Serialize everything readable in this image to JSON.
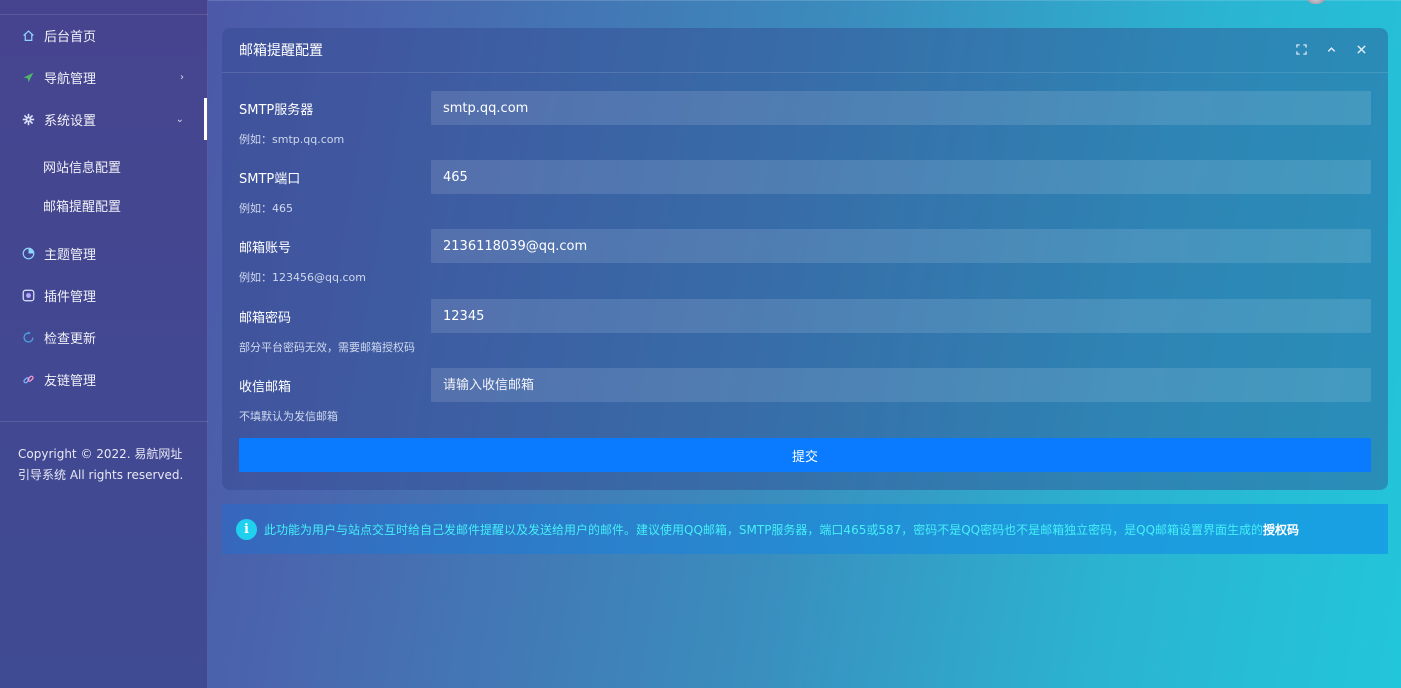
{
  "sidebar": {
    "items": [
      {
        "label": "后台首页",
        "icon": "home-icon"
      },
      {
        "label": "导航管理",
        "icon": "navigation-icon",
        "arrow": "›"
      },
      {
        "label": "系统设置",
        "icon": "gear-icon",
        "arrow": "⌄"
      },
      {
        "label": "主题管理",
        "icon": "theme-icon"
      },
      {
        "label": "插件管理",
        "icon": "plugin-icon"
      },
      {
        "label": "检查更新",
        "icon": "refresh-icon"
      },
      {
        "label": "友链管理",
        "icon": "link-icon"
      }
    ],
    "sub_items": [
      {
        "label": "网站信息配置"
      },
      {
        "label": "邮箱提醒配置"
      }
    ],
    "copyright": "Copyright © 2022. 易航网址引导系统 All rights reserved."
  },
  "card": {
    "title": "邮箱提醒配置",
    "fields": [
      {
        "label": "SMTP服务器",
        "value": "smtp.qq.com",
        "placeholder": "",
        "hint": "例如：smtp.qq.com"
      },
      {
        "label": "SMTP端口",
        "value": "465",
        "placeholder": "",
        "hint": "例如：465"
      },
      {
        "label": "邮箱账号",
        "value": "2136118039@qq.com",
        "placeholder": "",
        "hint": "例如：123456@qq.com"
      },
      {
        "label": "邮箱密码",
        "value": "12345",
        "placeholder": "",
        "hint": "部分平台密码无效，需要邮箱授权码"
      },
      {
        "label": "收信邮箱",
        "value": "",
        "placeholder": "请输入收信邮箱",
        "hint": "不填默认为发信邮箱"
      }
    ],
    "submit_label": "提交"
  },
  "notice": {
    "icon_text": "i",
    "text": "此功能为用户与站点交互时给自己发邮件提醒以及发送给用户的邮件。建议使用QQ邮箱，SMTP服务器，端口465或587，密码不是QQ密码也不是邮箱独立密码，是QQ邮箱设置界面生成的",
    "strong": "授权码"
  },
  "colors": {
    "accent": "#0a7bff",
    "notice_text": "#45f0f8"
  }
}
